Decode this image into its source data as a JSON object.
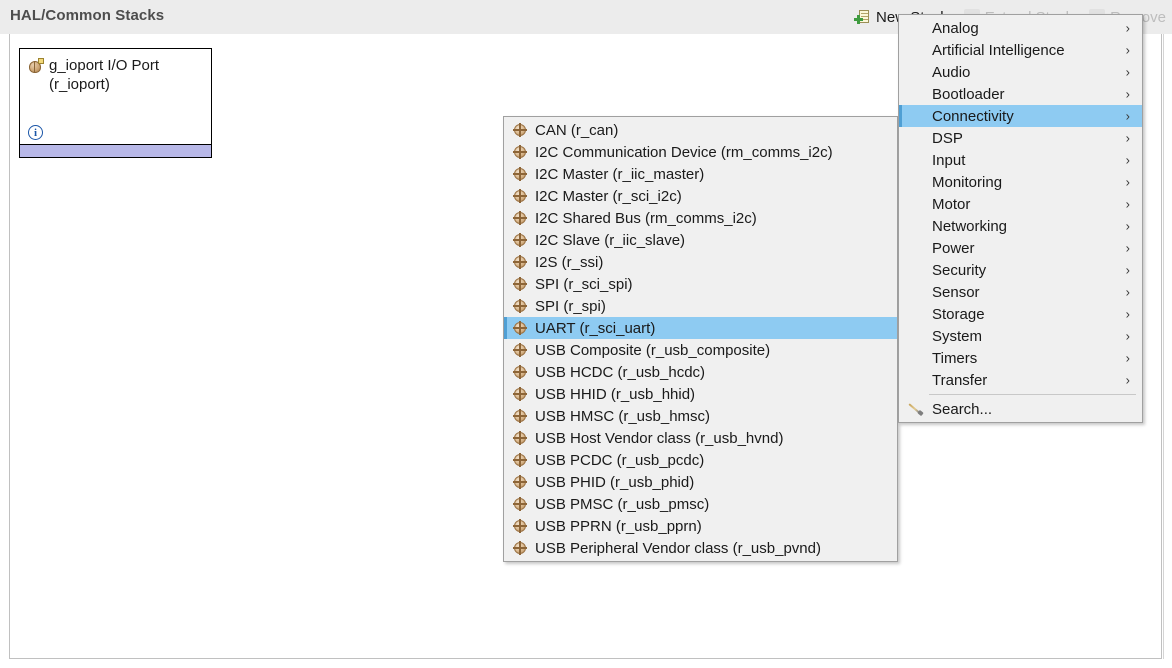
{
  "panel": {
    "title": "HAL/Common Stacks"
  },
  "toolbar": {
    "actions": [
      {
        "label": "New Stack",
        "icon": "new-stack-icon",
        "dimmed": false,
        "truncated": true
      },
      {
        "label": "Extend Stack",
        "icon": "extend-stack-icon",
        "dimmed": true,
        "truncated": false
      },
      {
        "label": "Remove",
        "icon": "remove-icon",
        "dimmed": true,
        "truncated": false
      }
    ]
  },
  "diagram": {
    "modules": [
      {
        "name": "g_ioport I/O Port\n(r_ioport)",
        "icon": "ioport-module-icon",
        "info_icon": "info-icon",
        "info_glyph": "i",
        "footer_color": "#b8b8e8"
      }
    ]
  },
  "category_menu": {
    "selected": "Connectivity",
    "arrow_glyph": "›",
    "items": [
      {
        "label": "Analog",
        "has_submenu": true
      },
      {
        "label": "Artificial Intelligence",
        "has_submenu": true
      },
      {
        "label": "Audio",
        "has_submenu": true
      },
      {
        "label": "Bootloader",
        "has_submenu": true
      },
      {
        "label": "Connectivity",
        "has_submenu": true
      },
      {
        "label": "DSP",
        "has_submenu": true
      },
      {
        "label": "Input",
        "has_submenu": true
      },
      {
        "label": "Monitoring",
        "has_submenu": true
      },
      {
        "label": "Motor",
        "has_submenu": true
      },
      {
        "label": "Networking",
        "has_submenu": true
      },
      {
        "label": "Power",
        "has_submenu": true
      },
      {
        "label": "Security",
        "has_submenu": true
      },
      {
        "label": "Sensor",
        "has_submenu": true
      },
      {
        "label": "Storage",
        "has_submenu": true
      },
      {
        "label": "System",
        "has_submenu": true
      },
      {
        "label": "Timers",
        "has_submenu": true
      },
      {
        "label": "Transfer",
        "has_submenu": true
      }
    ],
    "search_item": {
      "label": "Search...",
      "icon": "search-icon"
    }
  },
  "connectivity_submenu": {
    "selected": "UART (r_sci_uart)",
    "items": [
      {
        "label": "CAN (r_can)"
      },
      {
        "label": "I2C Communication Device (rm_comms_i2c)"
      },
      {
        "label": "I2C Master (r_iic_master)"
      },
      {
        "label": "I2C Master (r_sci_i2c)"
      },
      {
        "label": "I2C Shared Bus (rm_comms_i2c)"
      },
      {
        "label": "I2C Slave (r_iic_slave)"
      },
      {
        "label": "I2S (r_ssi)"
      },
      {
        "label": "SPI (r_sci_spi)"
      },
      {
        "label": "SPI (r_spi)"
      },
      {
        "label": "UART (r_sci_uart)"
      },
      {
        "label": "USB Composite (r_usb_composite)"
      },
      {
        "label": "USB HCDC (r_usb_hcdc)"
      },
      {
        "label": "USB HHID (r_usb_hhid)"
      },
      {
        "label": "USB HMSC (r_usb_hmsc)"
      },
      {
        "label": "USB Host Vendor class (r_usb_hvnd)"
      },
      {
        "label": "USB PCDC (r_usb_pcdc)"
      },
      {
        "label": "USB PHID (r_usb_phid)"
      },
      {
        "label": "USB PMSC (r_usb_pmsc)"
      },
      {
        "label": "USB PPRN (r_usb_pprn)"
      },
      {
        "label": "USB Peripheral Vendor class (r_usb_pvnd)"
      }
    ]
  },
  "colors": {
    "menu_background": "#f0f0f0",
    "highlight": "#8ecbf2",
    "highlight_edge": "#4f9fd4",
    "panel_header": "#ececec",
    "module_footer": "#b8b8e8",
    "info_blue": "#1b56a8"
  }
}
